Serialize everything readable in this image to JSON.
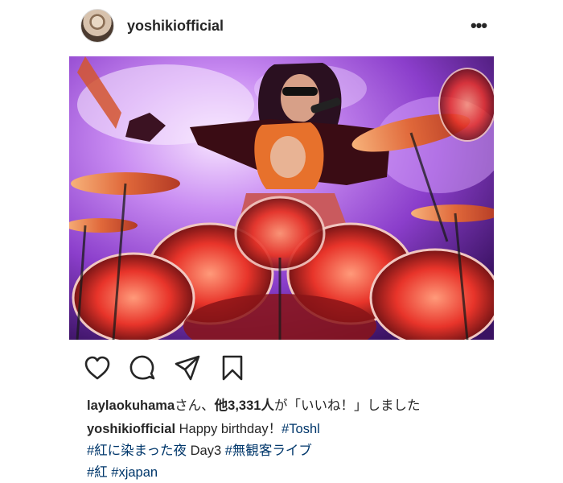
{
  "post": {
    "username": "yoshikiofficial",
    "more_label": "•••",
    "likes": {
      "user": "laylaokuhama",
      "middle": "さん、",
      "count_text": "他3,331人",
      "suffix": "が「いいね！」しました"
    },
    "caption": {
      "author": "yoshikiofficial",
      "text": "Happy birthday！",
      "tag_toshl": "#Toshl",
      "line2_tag1": "#紅に染まった夜",
      "line2_text": "Day3",
      "line2_tag2": "#無観客ライブ",
      "line3_tag1": "#紅",
      "line3_tag2": "#xjapan"
    }
  },
  "icons": {
    "more": "more-options-icon",
    "like": "heart-icon",
    "comment": "comment-bubble-icon",
    "share": "paper-plane-icon",
    "save": "bookmark-icon"
  },
  "colors": {
    "text": "#262626",
    "hashtag": "#00376b",
    "photo_purple": "#8a3fc9",
    "photo_red": "#e8342a"
  }
}
